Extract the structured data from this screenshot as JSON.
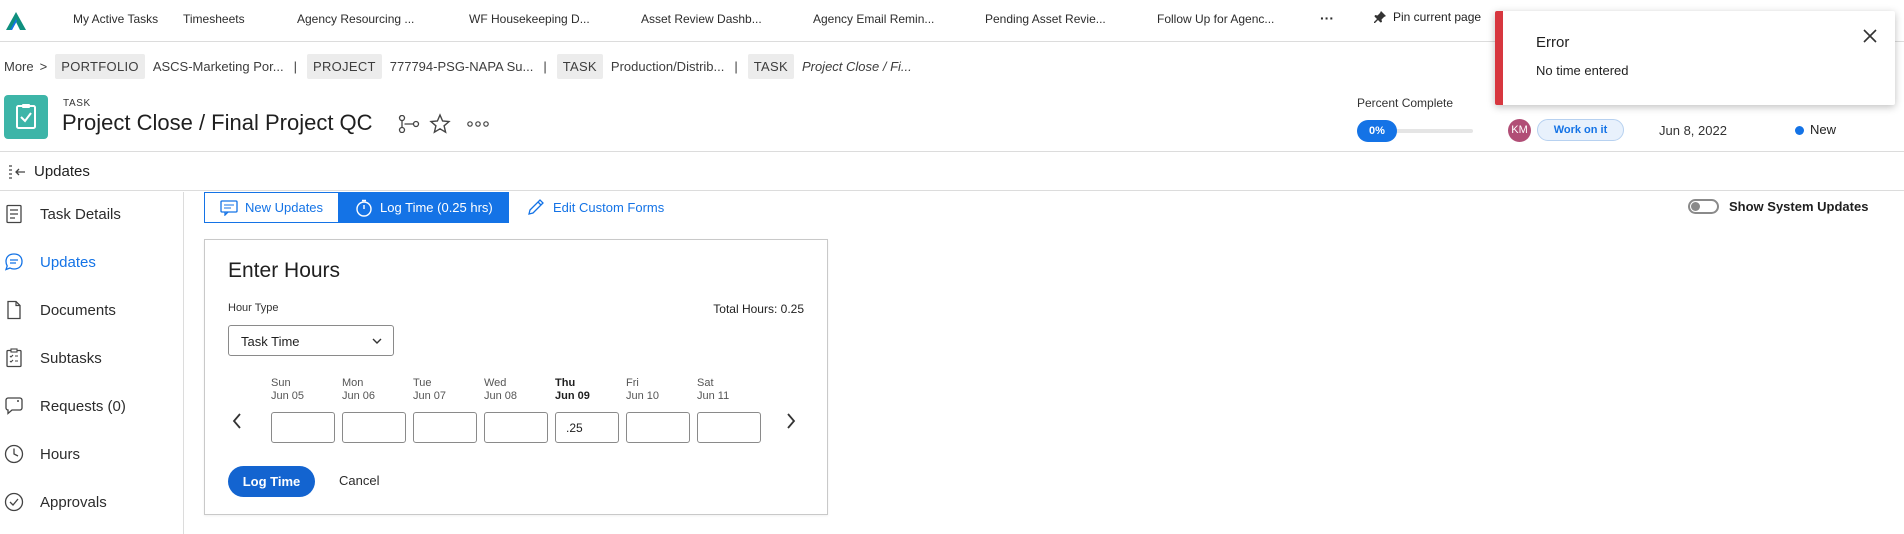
{
  "topbar": {
    "items": [
      "My Active Tasks",
      "Timesheets",
      "Agency Resourcing ...",
      "WF Housekeeping D...",
      "Asset Review Dashb...",
      "Agency Email Remin...",
      "Pending Asset Revie...",
      "Follow Up for Agenc..."
    ],
    "more": "···",
    "pin_label": "Pin current page"
  },
  "breadcrumb": {
    "more": "More",
    "portfolio_tag": "PORTFOLIO",
    "portfolio_name": "ASCS-Marketing Por...",
    "project_tag": "PROJECT",
    "project_name": "777794-PSG-NAPA Su...",
    "task_tag_1": "TASK",
    "task_name_1": "Production/Distrib...",
    "task_tag_2": "TASK",
    "task_name_2": "Project Close / Fi..."
  },
  "header": {
    "kicker": "TASK",
    "title": "Project Close / Final Project QC",
    "percent_label": "Percent Complete",
    "percent_value": "0%",
    "assignee_initials": "KM",
    "status": "Work on it",
    "due_date": "Jun 8, 2022",
    "condition": "New"
  },
  "updates": {
    "title": "Updates"
  },
  "nav": {
    "items": [
      "Task Details",
      "Updates",
      "Documents",
      "Subtasks",
      "Requests (0)",
      "Hours",
      "Approvals"
    ]
  },
  "tabs": {
    "new_updates": "New Updates",
    "log_time": "Log Time (0.25 hrs)",
    "edit_forms": "Edit Custom Forms",
    "show_system": "Show System Updates"
  },
  "hours": {
    "title": "Enter Hours",
    "hour_type_label": "Hour Type",
    "hour_type_value": "Task Time",
    "total": "Total Hours: 0.25",
    "days": [
      {
        "name": "Sun",
        "date": "Jun 05",
        "value": ""
      },
      {
        "name": "Mon",
        "date": "Jun 06",
        "value": ""
      },
      {
        "name": "Tue",
        "date": "Jun 07",
        "value": ""
      },
      {
        "name": "Wed",
        "date": "Jun 08",
        "value": ""
      },
      {
        "name": "Thu",
        "date": "Jun 09",
        "value": ".25"
      },
      {
        "name": "Fri",
        "date": "Jun 10",
        "value": ""
      },
      {
        "name": "Sat",
        "date": "Jun 11",
        "value": ""
      }
    ],
    "log_button": "Log Time",
    "cancel_button": "Cancel"
  },
  "toast": {
    "title": "Error",
    "message": "No time entered"
  },
  "colors": {
    "accent": "#1473e6",
    "error": "#d7373f",
    "task_icon": "#3db5a8"
  }
}
